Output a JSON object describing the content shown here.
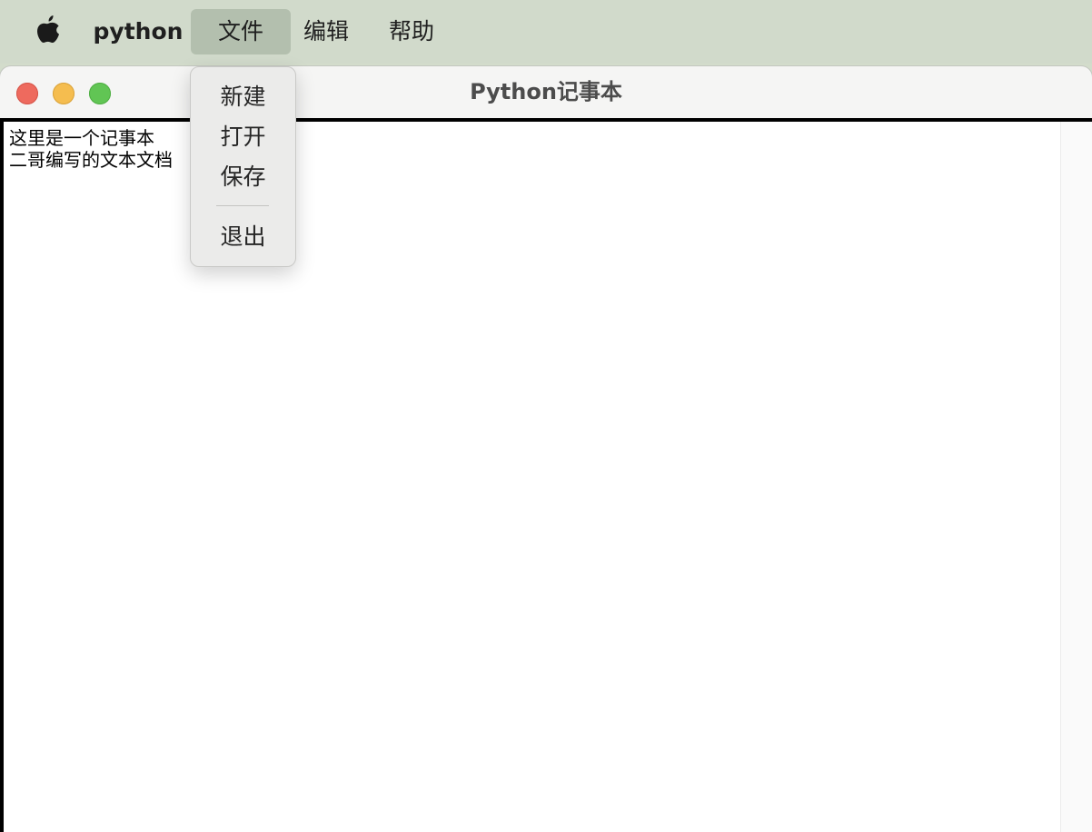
{
  "menubar": {
    "app_name": "python",
    "items": [
      {
        "label": "文件"
      },
      {
        "label": "编辑"
      },
      {
        "label": "帮助"
      }
    ]
  },
  "window": {
    "title": "Python记事本"
  },
  "file_menu": {
    "items": [
      {
        "label": "新建"
      },
      {
        "label": "打开"
      },
      {
        "label": "保存"
      },
      {
        "label": "退出"
      }
    ]
  },
  "editor": {
    "content": "这里是一个记事本\n二哥编写的文本文档"
  },
  "icons": {
    "apple": "apple-icon",
    "close": "close-icon",
    "minimize": "minimize-icon",
    "zoom": "zoom-icon"
  },
  "colors": {
    "close": "#ee6a5e",
    "minimize": "#f5bd4f",
    "zoom": "#61c554",
    "menu_highlight": "#b3bfae"
  }
}
